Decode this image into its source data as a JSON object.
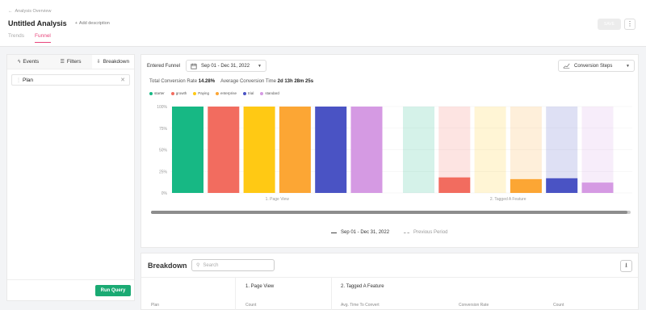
{
  "header": {
    "back_label": "Analysis Overview",
    "title": "Untitled Analysis",
    "add_description": "Add description",
    "tabs": [
      {
        "label": "Trends",
        "active": false
      },
      {
        "label": "Funnel",
        "active": true
      }
    ],
    "save_label": "SAVE",
    "more_icon": "vertical-dots-icon"
  },
  "left_panel": {
    "tabs": [
      {
        "label": "Events",
        "icon": "lightning-icon",
        "active": false
      },
      {
        "label": "Filters",
        "icon": "filter-icon",
        "active": false
      },
      {
        "label": "Breakdown",
        "icon": "breakdown-icon",
        "active": true
      }
    ],
    "breakdown_value": "Plan",
    "run_query_label": "Run Query"
  },
  "chart_panel": {
    "entered_funnel_label": "Entered Funnel",
    "date_range": "Sep 01 - Dec 31, 2022",
    "view_select": "Conversion Steps",
    "total_conversion_label": "Total Conversion Rate",
    "total_conversion_value": "14.28%",
    "avg_time_label": "Average Conversion Time",
    "avg_time_value": "2d 13h 28m 25s",
    "series_legend": [
      {
        "label": "Sep 01 - Dec 31, 2022",
        "style": "solid"
      },
      {
        "label": "Previous Period",
        "style": "dashed"
      }
    ]
  },
  "chart_data": {
    "type": "bar",
    "categories": [
      "1. Page View",
      "2. Tagged A Feature"
    ],
    "yticks": [
      "100%",
      "75%",
      "50%",
      "25%",
      "0%"
    ],
    "ylim": [
      0,
      100
    ],
    "grid": true,
    "legend_position": "top-left",
    "series": [
      {
        "name": "starter",
        "color": "#17b884",
        "values": [
          100,
          0
        ]
      },
      {
        "name": "growth",
        "color": "#f26c5f",
        "values": [
          100,
          18
        ]
      },
      {
        "name": "Paying",
        "color": "#ffc914",
        "values": [
          100,
          0
        ]
      },
      {
        "name": "enterprise",
        "color": "#fca634",
        "values": [
          100,
          16
        ]
      },
      {
        "name": "trial",
        "color": "#4a53c4",
        "values": [
          100,
          17
        ]
      },
      {
        "name": "standard",
        "color": "#d59ae3",
        "values": [
          100,
          12
        ]
      }
    ]
  },
  "breakdown": {
    "title": "Breakdown",
    "search_placeholder": "Search",
    "download_icon": "download-icon",
    "steps": [
      "1. Page View",
      "2. Tagged A Feature"
    ],
    "columns": [
      "Plan",
      "Count",
      "Avg. Time To Convert",
      "Conversion Rate",
      "Count"
    ]
  }
}
